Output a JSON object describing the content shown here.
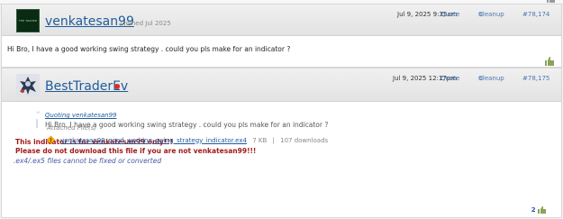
{
  "post1": {
    "username": "venkatesan99",
    "joined": "| Joined Jul 2025",
    "avatar_text": "THE TRADER",
    "date": "Jul 9, 2025 9:35am",
    "quote_label": "Quote",
    "cleanup_label": "Cleanup",
    "post_number": "#78,174",
    "body": "Hi Bro, I have a good working swing strategy . could you pls make for an indicator ?"
  },
  "post2": {
    "username": "BestTraderEv",
    "date": "Jul 9, 2025 12:17pm",
    "quote_label": "Quote",
    "cleanup_label": "Cleanup",
    "post_number": "#78,175",
    "quoting_label": "Quoting venkatesan99",
    "quoted_text": "Hi Bro, I have a good working swing strategy . could you pls make for an indicator ?",
    "warning_line1": "This indicator is for venkatesan99 only!!!",
    "warning_line2": "Please do not download this file if you are not venkatesan99!!!",
    "attached_label": "Attached File(s)",
    "attachment": {
      "filename": "venkatesan99_good_working_swing_strategy_indicator.ex4",
      "size": "7 KB",
      "downloads": "107 downloads"
    },
    "notice": ".ex4/.ex5 files cannot be fixed or converted",
    "like_count": "2"
  },
  "colors": {
    "link": "#1f5c9a",
    "warning": "#a11a1a",
    "status_dot": "#e02b2b"
  }
}
